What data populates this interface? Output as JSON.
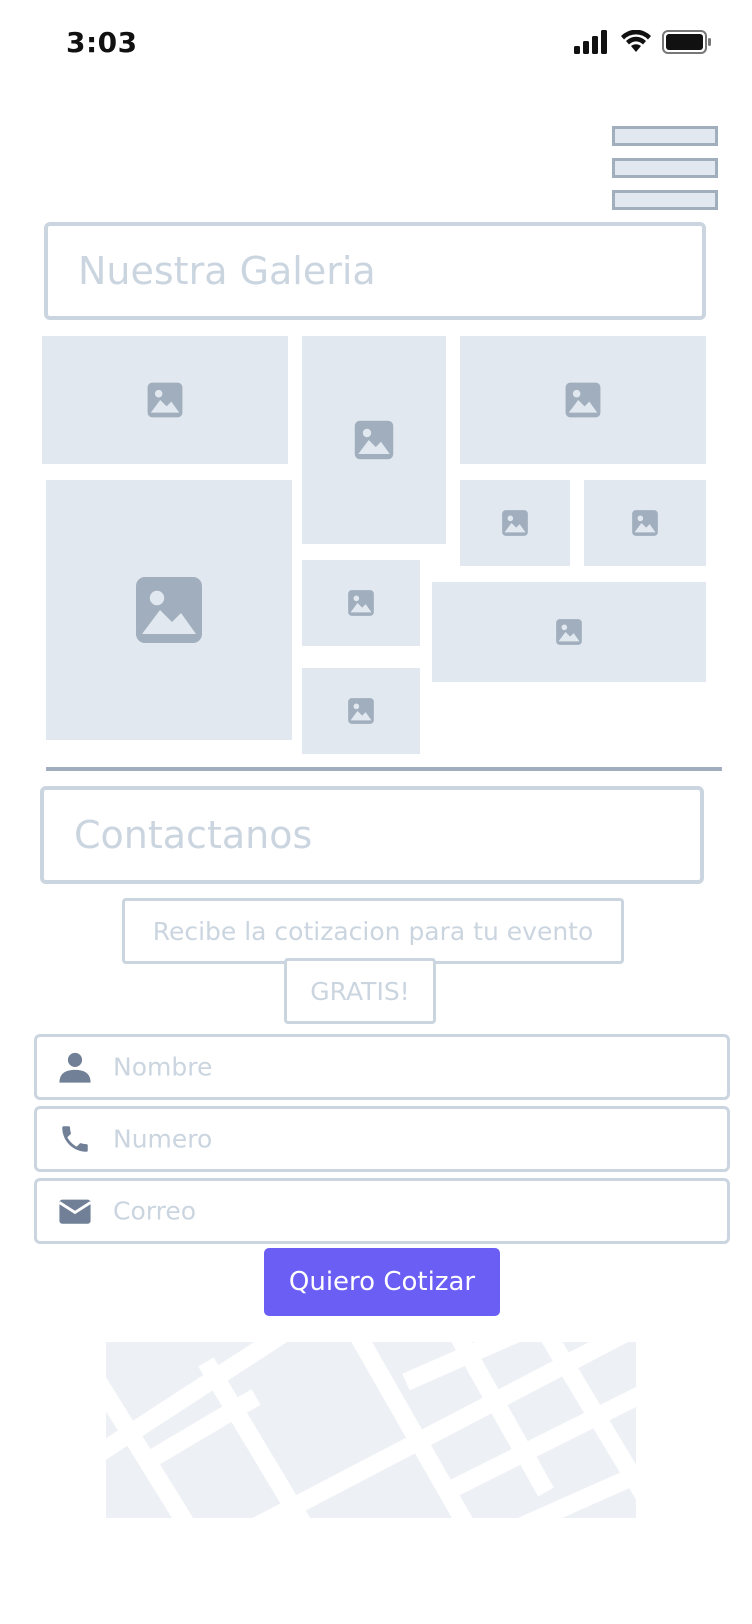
{
  "status_bar": {
    "time": "3:03"
  },
  "gallery": {
    "title": "Nuestra Galeria"
  },
  "contact": {
    "title": "Contactanos",
    "subtitle": "Recibe la cotizacion para tu evento",
    "badge": "GRATIS!",
    "fields": [
      {
        "icon": "user-icon",
        "placeholder": "Nombre"
      },
      {
        "icon": "phone-icon",
        "placeholder": "Numero"
      },
      {
        "icon": "mail-icon",
        "placeholder": "Correo"
      }
    ],
    "submit_label": "Quiero Cotizar"
  },
  "colors": {
    "accent": "#6a5ef5",
    "placeholder_fill": "#e2e8f0",
    "border": "#cbd5e0",
    "icon_gray": "#a0aebd"
  }
}
